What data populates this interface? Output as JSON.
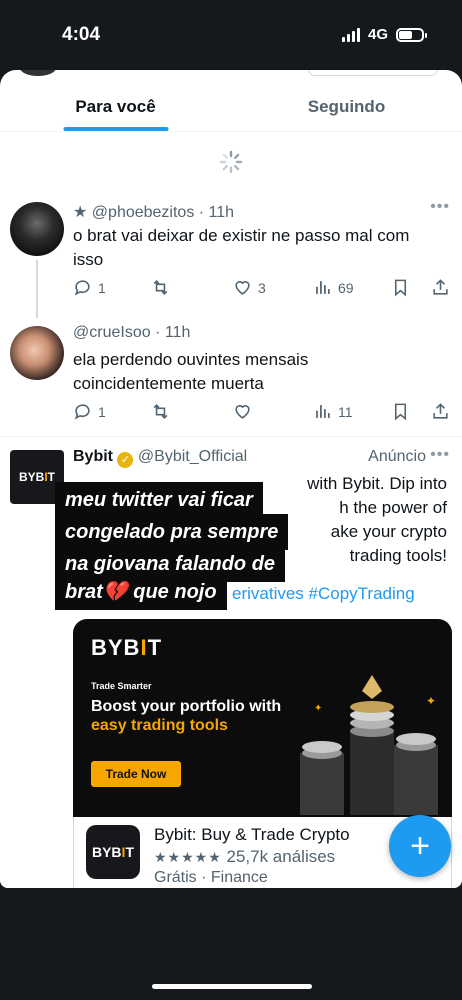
{
  "status_bar": {
    "time": "4:04",
    "network": "4G"
  },
  "tabs": [
    {
      "label": "Para você",
      "active": true
    },
    {
      "label": "Seguindo",
      "active": false
    }
  ],
  "tweets": [
    {
      "handle_prefix": "★",
      "handle": "@phoebezitos",
      "time": "· 11h",
      "text": "o brat vai deixar de existir ne passo mal com isso",
      "replies": "1",
      "retweets": "",
      "likes": "3",
      "views": "69"
    },
    {
      "handle": "@crueIsoo",
      "time": "· 11h",
      "text": "ela perdendo ouvintes mensais coincidentemente muerta",
      "replies": "1",
      "retweets": "",
      "likes": "",
      "views": "11"
    }
  ],
  "ad": {
    "name": "Bybit",
    "handle": "@Bybit_Official",
    "label": "Anúncio",
    "line1_visible": "with Bybit. Dip into",
    "line2_visible": "h the power of",
    "line3_visible": "ake your crypto",
    "line4_visible": "trading tools!",
    "hashtags": "erivatives #CopyTrading"
  },
  "overlay": {
    "line1": "meu twitter vai ficar",
    "line2": "congelado pra sempre",
    "line3": "na giovana falando de",
    "line4": "brat💔 que nojo"
  },
  "banner": {
    "logo_main": "BYB",
    "logo_bar": "I",
    "logo_end": "T",
    "tagline": "Trade Smarter",
    "headline1": "Boost your portfolio with",
    "headline2": "easy trading tools",
    "cta": "Trade Now"
  },
  "app_card": {
    "icon_main": "BYB",
    "icon_bar": "I",
    "icon_end": "T",
    "name": "Bybit: Buy & Trade Crypto",
    "stars": "★★★★★",
    "rating": "25,7k análises",
    "category": "Grátis · Finance"
  },
  "fab": {
    "symbol": "+"
  },
  "colors": {
    "accent": "#1d9bf0",
    "bybit_orange": "#f7a600"
  }
}
